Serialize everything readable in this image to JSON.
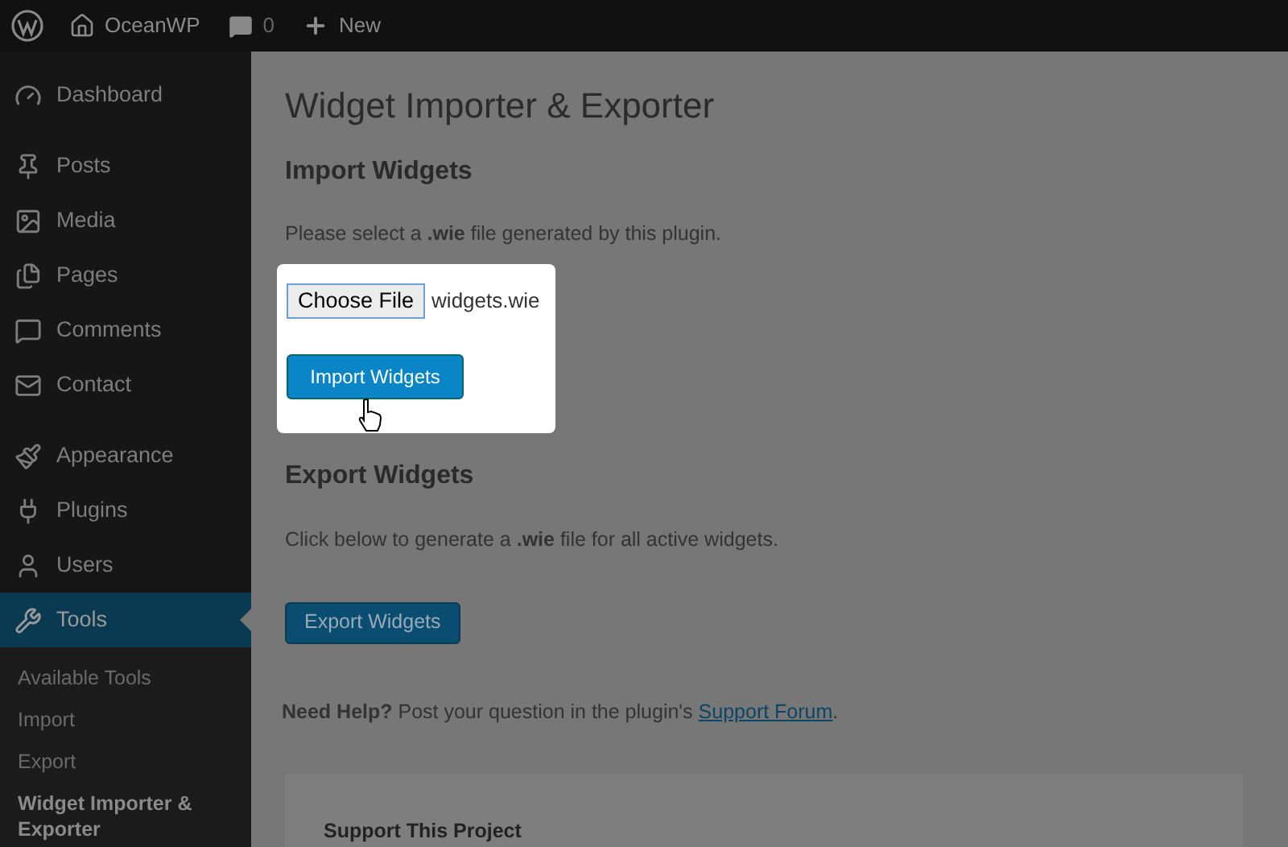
{
  "admin_bar": {
    "site": "OceanWP",
    "comments": "0",
    "new": "New"
  },
  "sidebar": {
    "groups": [
      {
        "items": [
          {
            "label": "Dashboard",
            "selected": false
          }
        ]
      },
      {
        "items": [
          {
            "label": "Posts",
            "selected": false
          },
          {
            "label": "Media",
            "selected": false
          },
          {
            "label": "Pages",
            "selected": false
          },
          {
            "label": "Comments",
            "selected": false
          },
          {
            "label": "Contact",
            "selected": false
          }
        ]
      },
      {
        "items": [
          {
            "label": "Appearance",
            "selected": false
          },
          {
            "label": "Plugins",
            "selected": false
          },
          {
            "label": "Users",
            "selected": false
          },
          {
            "label": "Tools",
            "selected": true,
            "children": [
              {
                "label": "Available Tools",
                "selected": false
              },
              {
                "label": "Import",
                "selected": false
              },
              {
                "label": "Export",
                "selected": false
              },
              {
                "label": "Widget Importer & Exporter",
                "selected": true
              }
            ]
          }
        ]
      }
    ]
  },
  "page": {
    "title": "Widget Importer & Exporter",
    "import": {
      "heading": "Import Widgets",
      "text": "Please select a **.wie** file generated by this plugin.",
      "file_button": "Choose File",
      "file_name": "widgets.wie",
      "button": "Import Widgets"
    },
    "export": {
      "heading": "Export Widgets",
      "text": "Click below to generate a **.wie** file for all active widgets.",
      "button": "Export Widgets"
    },
    "help": {
      "label": "Need Help?",
      "text": "Post your question in the plugin's",
      "link": "Support Forum",
      "after": "."
    },
    "support": {
      "heading": "Support This Project"
    }
  }
}
